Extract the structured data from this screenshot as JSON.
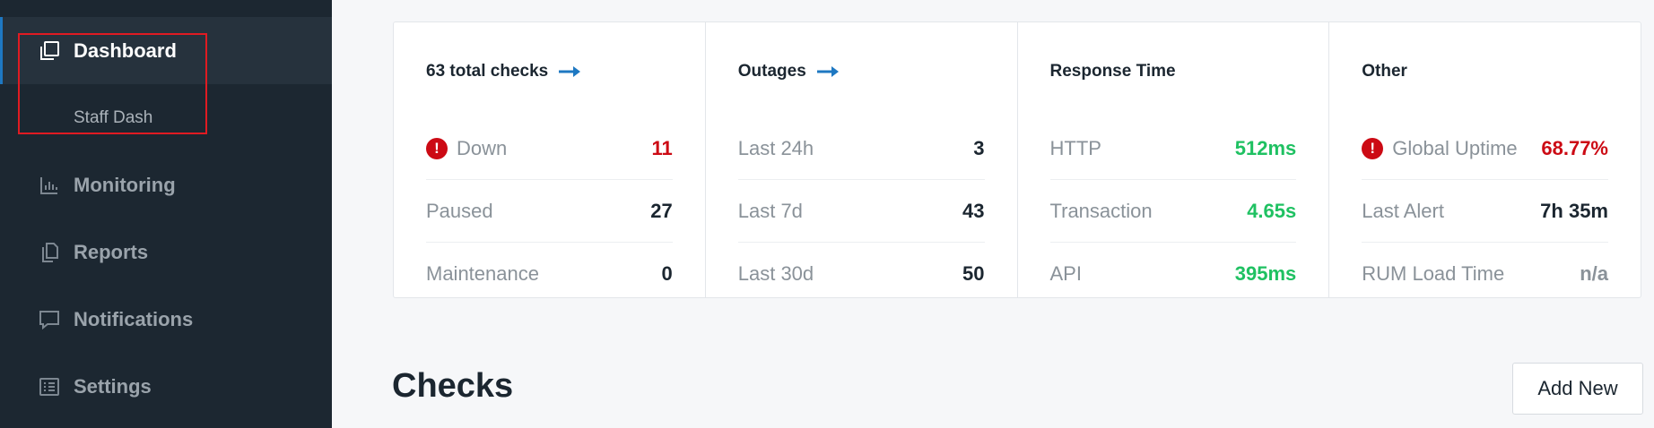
{
  "sidebar": {
    "items": [
      {
        "label": "Dashboard",
        "icon": "dashboard-icon"
      },
      {
        "label": "Staff Dash"
      },
      {
        "label": "Monitoring",
        "icon": "bar-chart-icon"
      },
      {
        "label": "Reports",
        "icon": "reports-icon"
      },
      {
        "label": "Notifications",
        "icon": "chat-bubble-icon"
      },
      {
        "label": "Settings",
        "icon": "list-icon"
      }
    ]
  },
  "stats": {
    "checks": {
      "title": "63 total checks",
      "rows": [
        {
          "label": "Down",
          "value": "11"
        },
        {
          "label": "Paused",
          "value": "27"
        },
        {
          "label": "Maintenance",
          "value": "0"
        }
      ]
    },
    "outages": {
      "title": "Outages",
      "rows": [
        {
          "label": "Last 24h",
          "value": "3"
        },
        {
          "label": "Last 7d",
          "value": "43"
        },
        {
          "label": "Last 30d",
          "value": "50"
        }
      ]
    },
    "response": {
      "title": "Response Time",
      "rows": [
        {
          "label": "HTTP",
          "value": "512ms"
        },
        {
          "label": "Transaction",
          "value": "4.65s"
        },
        {
          "label": "API",
          "value": "395ms"
        }
      ]
    },
    "other": {
      "title": "Other",
      "rows": [
        {
          "label": "Global Uptime",
          "value": "68.77%"
        },
        {
          "label": "Last Alert",
          "value": "7h 35m"
        },
        {
          "label": "RUM Load Time",
          "value": "n/a"
        }
      ]
    }
  },
  "checks_section": {
    "title": "Checks",
    "add_new_label": "Add New"
  },
  "colors": {
    "sidebar_bg": "#1c2731",
    "accent_blue": "#1e78c2",
    "error_red": "#cc0a14",
    "success_green": "#1fc162",
    "highlight_red": "#e01b22"
  }
}
